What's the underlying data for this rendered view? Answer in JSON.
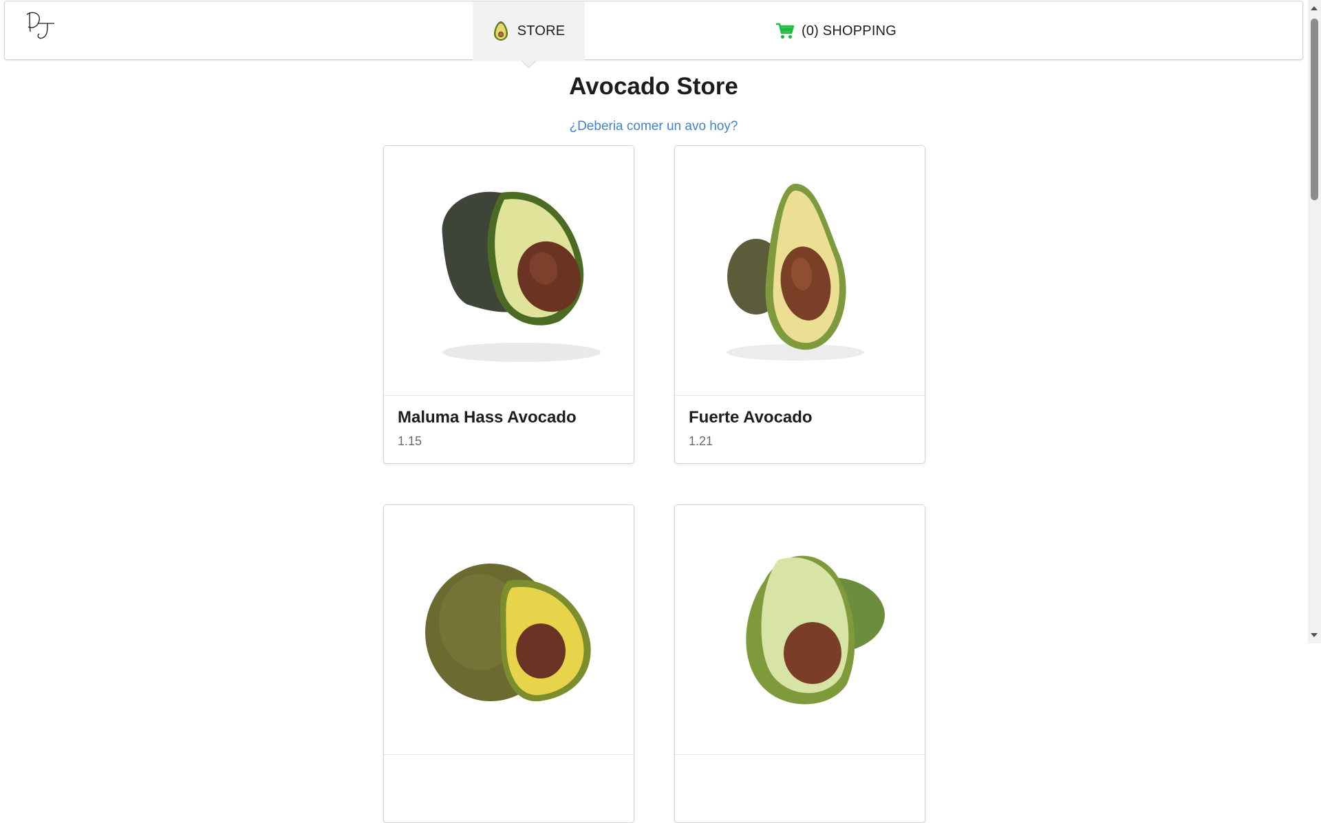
{
  "nav": {
    "store_label": "STORE",
    "cart_label": "(0) SHOPPING",
    "logo_icon": "dj-signature-logo",
    "store_icon": "avocado-icon",
    "cart_icon": "shopping-cart-icon",
    "cart_icon_color": "#21ba45"
  },
  "header": {
    "title": "Avocado Store",
    "subtitle_link": "¿Deberia comer un avo hoy?",
    "link_color": "#4183c4"
  },
  "products": [
    {
      "name": "Maluma Hass Avocado",
      "price": "1.15",
      "image": "avocado-half-dark-skin"
    },
    {
      "name": "Fuerte Avocado",
      "price": "1.21",
      "image": "avocado-half-pear-shaped"
    },
    {
      "name": "",
      "price": "",
      "image": "avocado-half-speckled-skin"
    },
    {
      "name": "",
      "price": "",
      "image": "avocado-half-green-skin"
    }
  ]
}
